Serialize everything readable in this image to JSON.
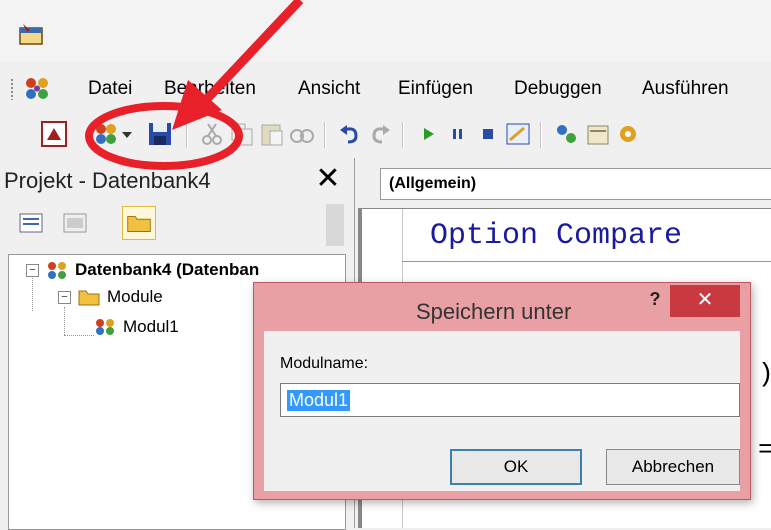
{
  "menu": {
    "items": [
      "Datei",
      "Bearbeiten",
      "Ansicht",
      "Einfügen",
      "Debuggen",
      "Ausführen"
    ]
  },
  "project_pane": {
    "title": "Projekt - Datenbank4",
    "close_label": "✕"
  },
  "tree": {
    "root": "Datenbank4 (Datenban",
    "folder": "Module",
    "module": "Modul1"
  },
  "code": {
    "object_combo": "(Allgemein)",
    "first_line": "Option Compare"
  },
  "dialog": {
    "title": "Speichern unter",
    "help_label": "?",
    "close_label": "✕",
    "field_label": "Modulname:",
    "field_value": "Modul1",
    "ok_label": "OK",
    "cancel_label": "Abbrechen"
  },
  "colors": {
    "annotation_red": "#e8202a",
    "dialog_frame": "#e9a0a4",
    "dialog_close": "#c83a40",
    "code_keyword": "#1a1aa0",
    "selection": "#3399ff"
  }
}
